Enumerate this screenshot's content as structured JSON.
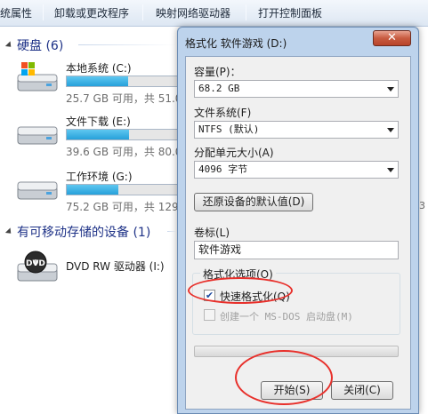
{
  "toolbar": {
    "items": [
      "统属性",
      "卸载或更改程序",
      "映射网络驱动器",
      "打开控制面板"
    ]
  },
  "groups": {
    "hdd": {
      "title": "硬盘 (6)"
    },
    "removable": {
      "title": "有可移动存储的设备 (1)"
    }
  },
  "drives": [
    {
      "name": "本地系统 (C:)",
      "info": "25.7 GB 可用，共 51.0",
      "fill": 0.5,
      "icon": "windows-drive-icon"
    },
    {
      "name": "文件下载 (E:)",
      "info": "39.6 GB 可用，共 80.0",
      "fill": 0.51,
      "icon": "hard-drive-icon"
    },
    {
      "name": "工作环境 (G:)",
      "info": "75.2 GB 可用，共 129",
      "fill": 0.42,
      "icon": "hard-drive-icon"
    }
  ],
  "dvd": {
    "name": "DVD RW 驱动器 (I:)",
    "badge": "DVD",
    "icon": "dvd-drive-icon"
  },
  "side_text": "3",
  "dialog": {
    "title": "格式化 软件游戏 (D:)",
    "close_label": "✕",
    "capacity_label": "容量(P)：",
    "capacity_value": "68.2 GB",
    "fs_label": "文件系统(F)",
    "fs_value": "NTFS (默认)",
    "alloc_label": "分配单元大小(A)",
    "alloc_value": "4096 字节",
    "restore_button": "还原设备的默认值(D)",
    "volume_label": "卷标(L)",
    "volume_value": "软件游戏",
    "options_legend": "格式化选项(O)",
    "quick_format_label": "快速格式化(Q)",
    "quick_format_checked": true,
    "msdos_label": "创建一个 MS-DOS 启动盘(M)",
    "msdos_checked": false,
    "progress": 0,
    "start_button": "开始(S)",
    "close_button": "关闭(C)"
  },
  "colors": {
    "annotation": "#e8302b",
    "drive_fill": "#26a0da",
    "group_header": "#1e3287"
  }
}
